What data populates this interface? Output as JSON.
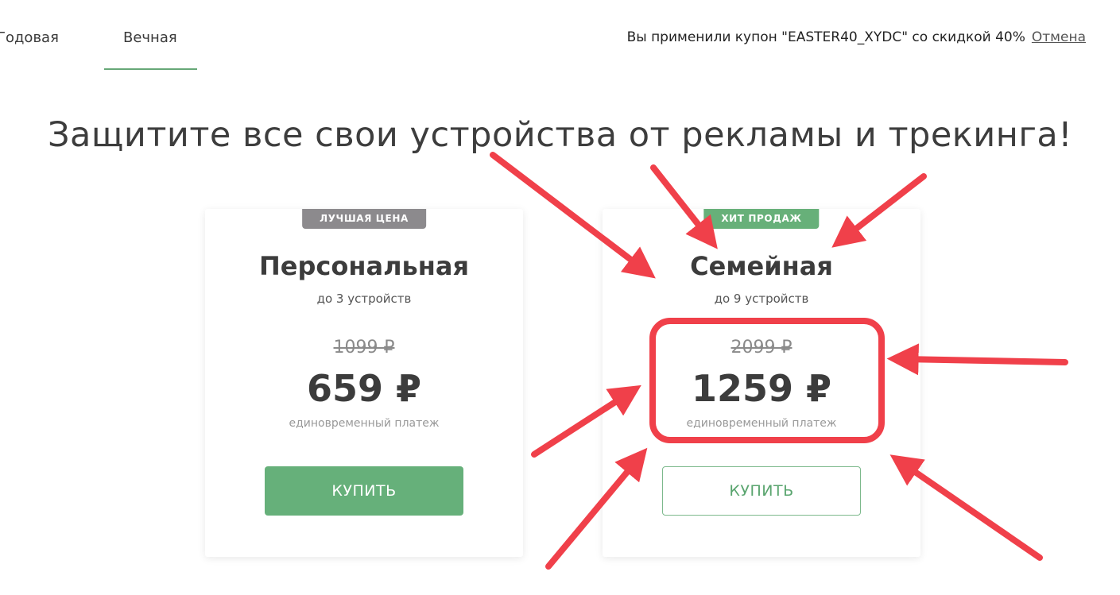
{
  "tabs": [
    {
      "label": "Годовая",
      "active": false
    },
    {
      "label": "Вечная",
      "active": true
    }
  ],
  "coupon": {
    "message": "Вы применили купон \"EASTER40_XYDC\" со скидкой 40%",
    "cancel_label": "Отмена"
  },
  "headline": "Защитите все свои устройства от рекламы и трекинга!",
  "plans": [
    {
      "badge": "ЛУЧШАЯ ЦЕНА",
      "name": "Персональная",
      "devices": "до 3 устройств",
      "old_price": "1099 ₽",
      "price": "659 ₽",
      "note": "единовременный платеж",
      "buy_label": "КУПИТЬ"
    },
    {
      "badge": "ХИТ ПРОДАЖ",
      "name": "Семейная",
      "devices": "до 9 устройств",
      "old_price": "2099 ₽",
      "price": "1259 ₽",
      "note": "единовременный платеж",
      "buy_label": "КУПИТЬ"
    }
  ],
  "colors": {
    "accent_green": "#66b07a",
    "badge_grey": "#8c8a8d",
    "annotation_red": "#f0404a"
  }
}
